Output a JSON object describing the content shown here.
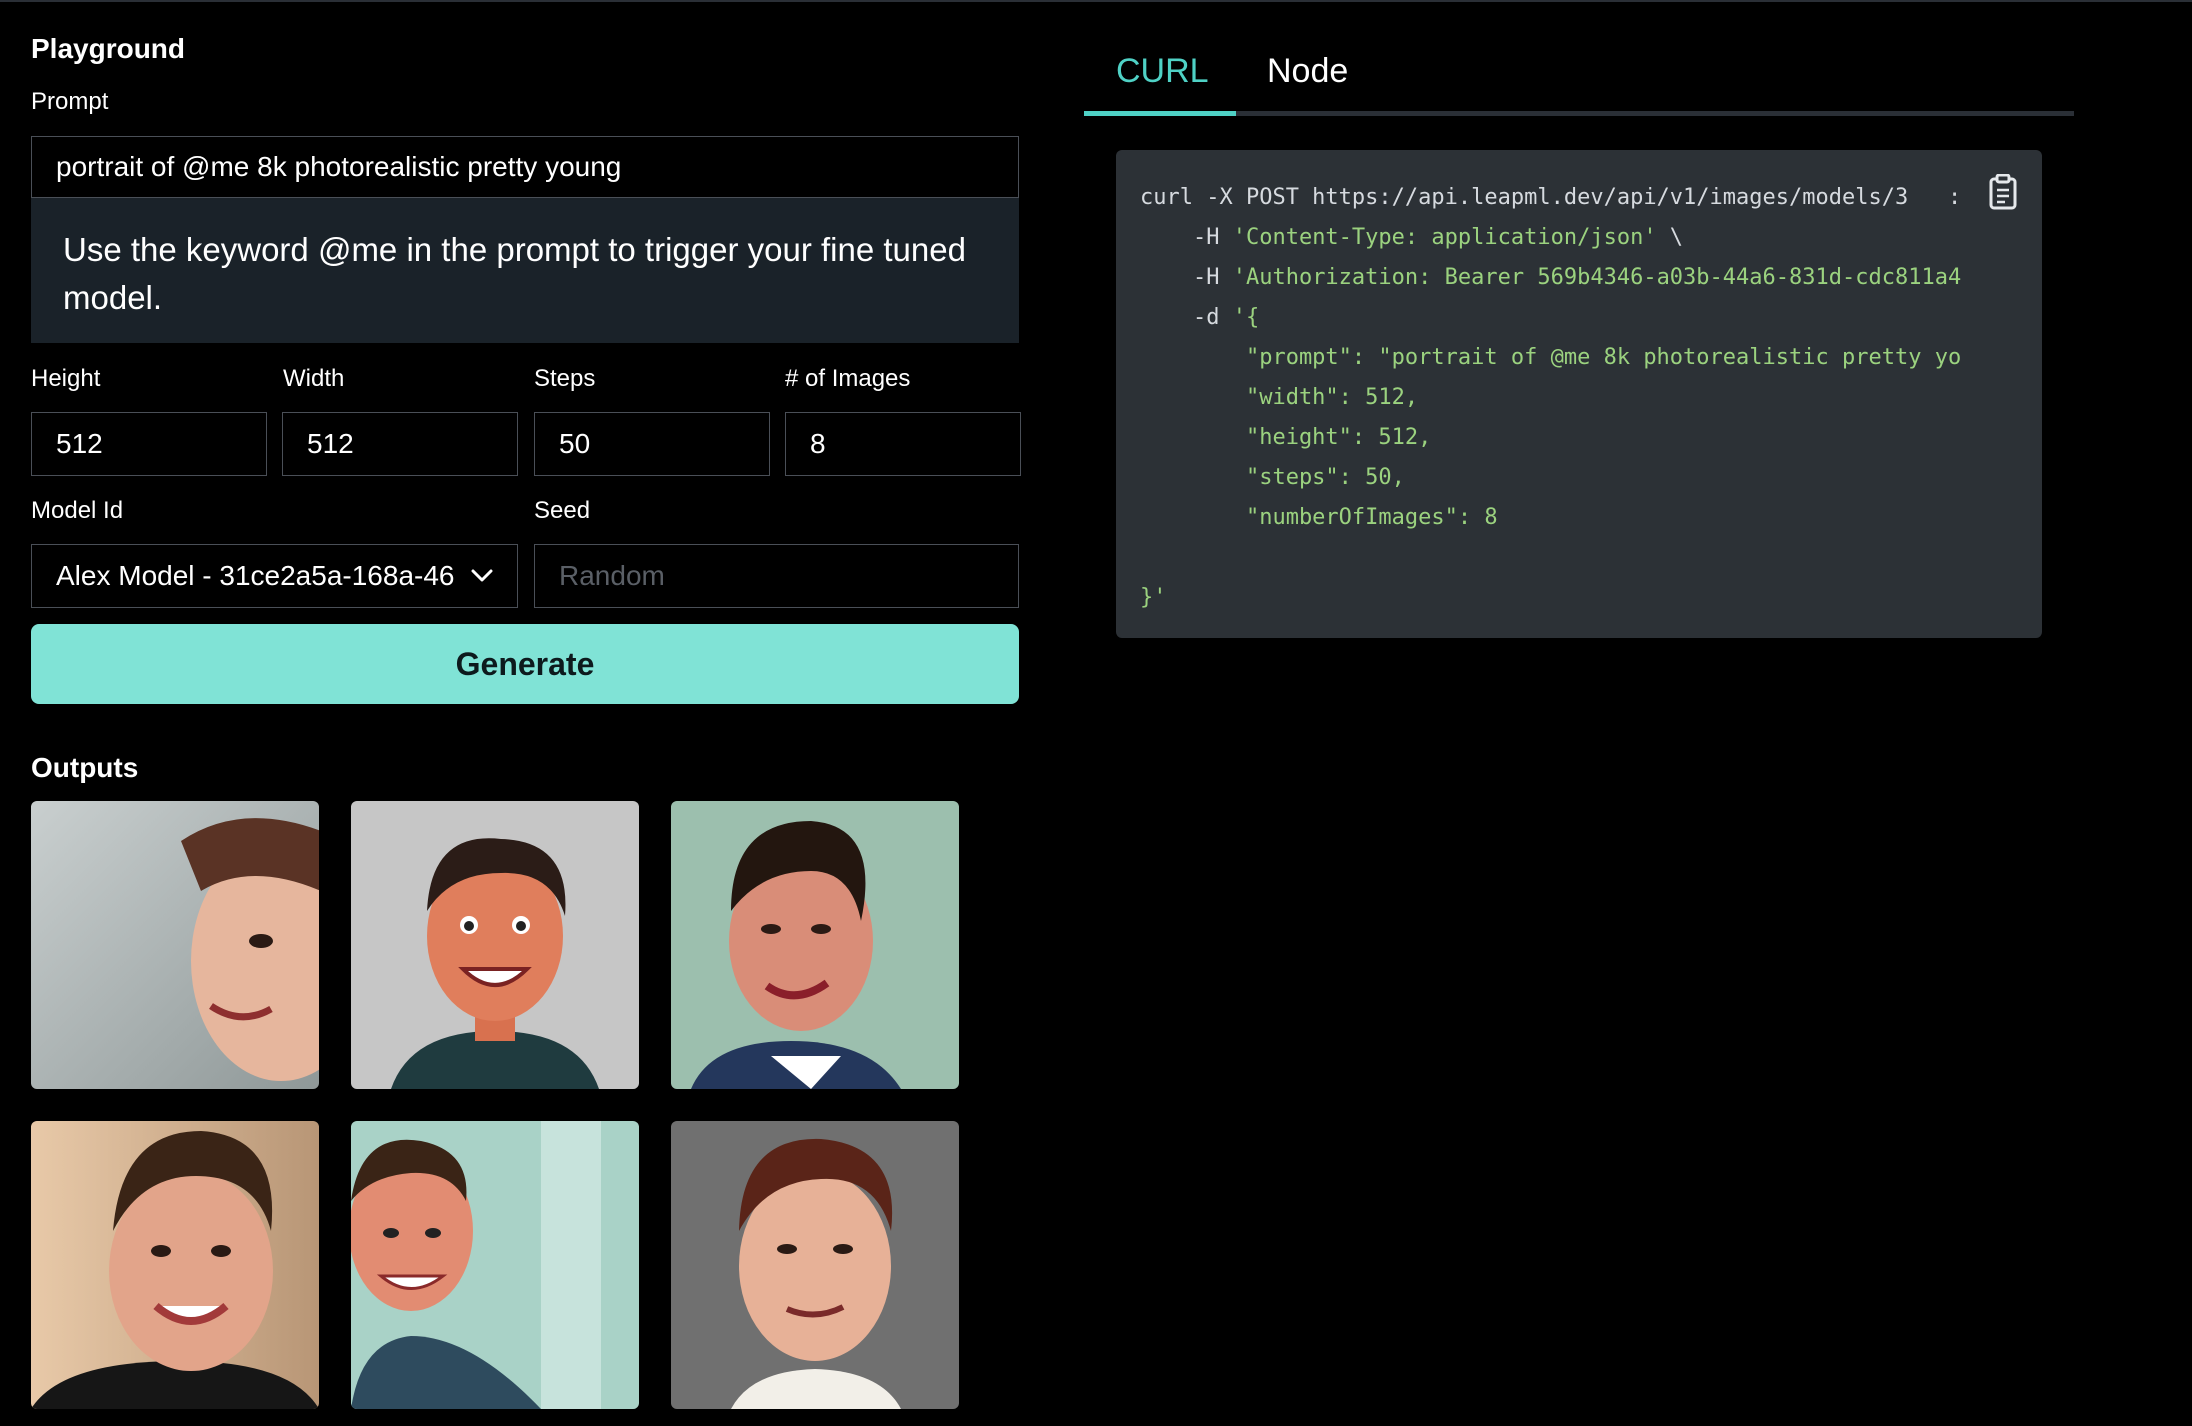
{
  "playground": {
    "title": "Playground",
    "prompt_label": "Prompt",
    "prompt_value": "portrait of @me 8k photorealistic pretty young",
    "tip": "Use the keyword @me in the prompt to trigger your fine tuned model.",
    "height_label": "Height",
    "height_value": "512",
    "width_label": "Width",
    "width_value": "512",
    "steps_label": "Steps",
    "steps_value": "50",
    "images_label": "# of Images",
    "images_value": "8",
    "model_label": "Model Id",
    "model_value": "Alex Model - 31ce2a5a-168a-46",
    "seed_label": "Seed",
    "seed_placeholder": "Random",
    "generate_label": "Generate"
  },
  "outputs": {
    "title": "Outputs",
    "images": [
      {
        "alt": "portrait-1",
        "bg": "#b9bfbf"
      },
      {
        "alt": "portrait-2",
        "bg": "#c8c8c8"
      },
      {
        "alt": "portrait-3",
        "bg": "#9cbfae"
      },
      {
        "alt": "portrait-4",
        "bg": "#d8b89a"
      },
      {
        "alt": "portrait-5",
        "bg": "#a9d2c7"
      },
      {
        "alt": "portrait-6",
        "bg": "#6e6e6e"
      }
    ]
  },
  "code_panel": {
    "tabs": [
      "CURL",
      "Node"
    ],
    "active_tab": "CURL",
    "line1_cmd": "curl -X POST https://api.leapml.dev/api/v1/images/models/3",
    "line1_tail": ":",
    "line2_flag": "    -H ",
    "line2_str": "'Content-Type: application/json'",
    "line2_tail": " \\",
    "line3_flag": "    -H ",
    "line3_str": "'Authorization: Bearer 569b4346-a03b-44a6-831d-cdc811a4",
    "line4_flag": "    -d ",
    "line4_str": "'{",
    "line5": "        \"prompt\": \"portrait of @me 8k photorealistic pretty yo",
    "line6": "        \"width\": 512,",
    "line7": "        \"height\": 512,",
    "line8": "        \"steps\": 50,",
    "line9": "        \"numberOfImages\": 8",
    "line11": "}'"
  },
  "colors": {
    "accent": "#4fd1c5",
    "button": "#80e3d6",
    "code_bg": "#2c3136",
    "code_string": "#9bd27f"
  }
}
